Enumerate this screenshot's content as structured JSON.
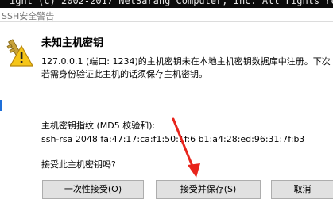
{
  "background": {
    "terminal_text": "ight (c) 2002-2017 NetSarang Computer, Inc. All rights rese"
  },
  "window": {
    "title": "SSH安全警告"
  },
  "dialog": {
    "heading": "未知主机密钥",
    "message_line1": "127.0.0.1 (端口: 1234)的主机密钥未在本地主机密钥数据库中注册。下次",
    "message_line2": "若需身份验证此主机的话须保存主机密钥。",
    "fingerprint_label": "主机密钥指纹 (MD5 校验和):",
    "fingerprint_value": "ssh-rsa 2048 fa:47:17:ca:f1:50:1f:6  b1:a4:28:ed:96:31:7f:b3",
    "question": "接受此主机密钥吗?"
  },
  "buttons": {
    "accept_once": "一次性接受(O)",
    "accept_and_save": "接受并保存(S)",
    "cancel": "取消"
  },
  "colors": {
    "arrow": "#e8241c",
    "button_bg": "#e1e1e1",
    "warning_yellow": "#f5c518"
  }
}
